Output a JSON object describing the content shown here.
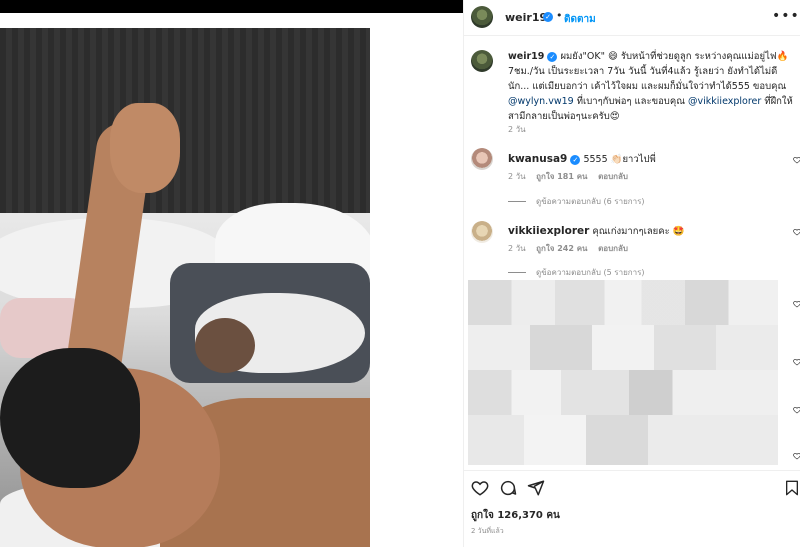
{
  "post": {
    "username": "weir19",
    "follow_label": "ติดตาม",
    "more_label": "•••",
    "caption_text": "ผมยัง\"OK\" 😄 รับหน้าที่ช่วยดูลูก ระหว่างคุณแม่อยู่ไฟ🔥 7ชม./วัน เป็นระยะเวลา 7วัน วันนี้ วันที่4แล้ว รู้เลยว่า ยังทำได้ไม่ดีนัก... แต่เมียบอกว่า เค้าไว้ใจผม และผมก็มั่นใจว่าทำได้555 ขอบคุณ",
    "mention1": "@wylyn.vw19",
    "caption_mid": " ที่เบาๆกับพ่อๆ และขอบคุณ ",
    "mention2": "@vikkiiexplorer",
    "caption_end": " ที่ฝึกให้สามีกลายเป็นพ่อๆนะครับ😍",
    "caption_time": "2 วัน",
    "likes": "ถูกใจ 126,370 คน",
    "posted": "2 วันที่แล้ว"
  },
  "comments": [
    {
      "username": "kwanusa9",
      "text": "5555 👏🏻ยาวไปพี่",
      "time": "2 วัน",
      "likes": "ถูกใจ 181 คน",
      "reply_label": "ตอบกลับ",
      "view_replies": "ดูข้อความตอบกลับ (6 รายการ)"
    },
    {
      "username": "vikkiiexplorer",
      "text": "คุณเก่งมากๆเลยคะ 🤩",
      "time": "2 วัน",
      "likes": "ถูกใจ 242 คน",
      "reply_label": "ตอบกลับ",
      "view_replies": "ดูข้อความตอบกลับ (5 รายการ)"
    }
  ],
  "icons": [
    "heart-icon",
    "comment-icon",
    "share-icon",
    "bookmark-icon",
    "verified-icon",
    "more-icon"
  ],
  "colors": {
    "accent": "#0095f6",
    "verified": "#1a8cff",
    "mention": "#00376b",
    "muted": "#8e8e8e"
  }
}
